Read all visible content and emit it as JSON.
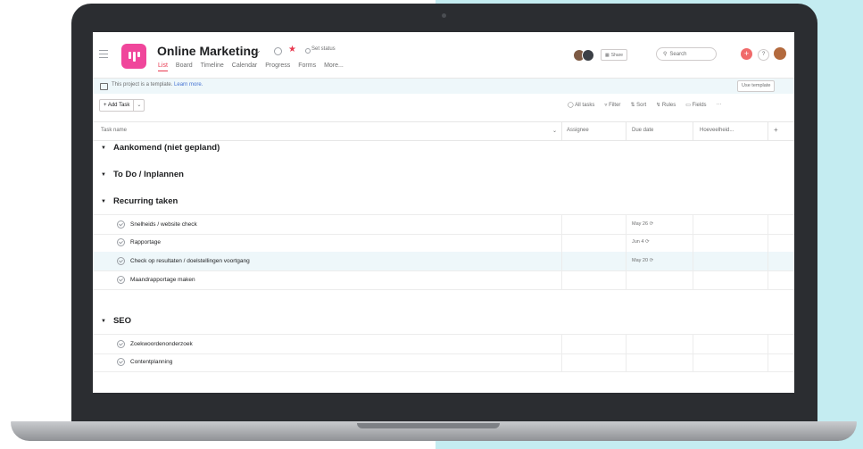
{
  "header": {
    "project_title": "Online Marketing",
    "set_status": "Set status",
    "tabs": [
      "List",
      "Board",
      "Timeline",
      "Calendar",
      "Progress",
      "Forms",
      "More..."
    ],
    "share_label": "Share",
    "search_placeholder": "Search",
    "help_label": "?"
  },
  "banner": {
    "text": "This project is a template.",
    "link": "Learn more.",
    "button": "Use template"
  },
  "toolbar": {
    "add_task": "+ Add Task",
    "all_tasks": "All tasks",
    "filter": "Filter",
    "sort": "Sort",
    "rules": "Rules",
    "fields": "Fields",
    "more": "···"
  },
  "table": {
    "columns": [
      "Task name",
      "Assignee",
      "Due date",
      "Hoeveelheid...",
      "+"
    ]
  },
  "sections": [
    {
      "title": "Aankomend (niet gepland)"
    },
    {
      "title": "To Do / Inplannen"
    },
    {
      "title": "Recurring taken"
    },
    {
      "title": "SEO"
    }
  ],
  "recurring_tasks": [
    {
      "name": "Snelheids / website check",
      "due": "May 26"
    },
    {
      "name": "Rapportage",
      "due": "Jun 4"
    },
    {
      "name": "Check op resultaten / doelstellingen voortgang",
      "due": "May 20"
    },
    {
      "name": "Maandrapportage maken",
      "due": ""
    }
  ],
  "seo_tasks": [
    {
      "name": "Zoekwoordenonderzoek",
      "due": ""
    },
    {
      "name": "Contentplanning",
      "due": ""
    }
  ],
  "colors": {
    "accent": "#f0469b",
    "active_tab": "#e8384f",
    "highlight_row": "#eef7fa",
    "link": "#4573d2"
  }
}
